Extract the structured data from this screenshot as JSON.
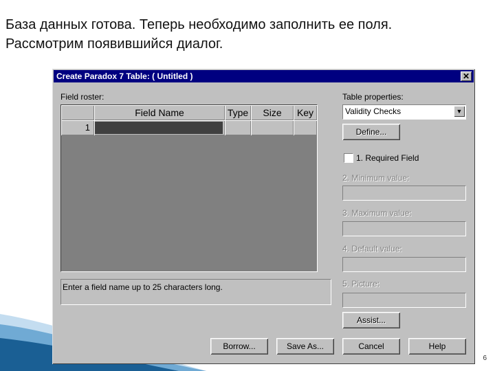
{
  "caption": {
    "line1": "База данных готова. Теперь необходимо заполнить ее поля.",
    "line2": "Рассмотрим появившийся диалог."
  },
  "dialog": {
    "title": "Create Paradox 7 Table: ( Untitled )",
    "close_glyph": "✕",
    "field_roster_label": "Field roster:",
    "columns": [
      "Field Name",
      "Type",
      "Size",
      "Key"
    ],
    "row_number": "1",
    "status_text": "Enter a field name up to 25 characters long.",
    "table_properties_label": "Table properties:",
    "table_properties_value": "Validity Checks",
    "dropdown_glyph": "▼",
    "define_button": "Define...",
    "required_field_label": "1. Required Field",
    "minimum_label": "2. Minimum value:",
    "maximum_label": "3. Maximum value:",
    "default_label": "4. Default value:",
    "picture_label": "5. Picture:",
    "assist_button": "Assist...",
    "buttons": {
      "borrow": "Borrow...",
      "save_as": "Save As...",
      "cancel": "Cancel",
      "help": "Help"
    }
  },
  "slide_number": "6",
  "colors": {
    "titlebar": "#000080",
    "dialog_bg": "#c0c0c0",
    "grid_bg": "#808080",
    "wave": "#1a6fa8"
  }
}
